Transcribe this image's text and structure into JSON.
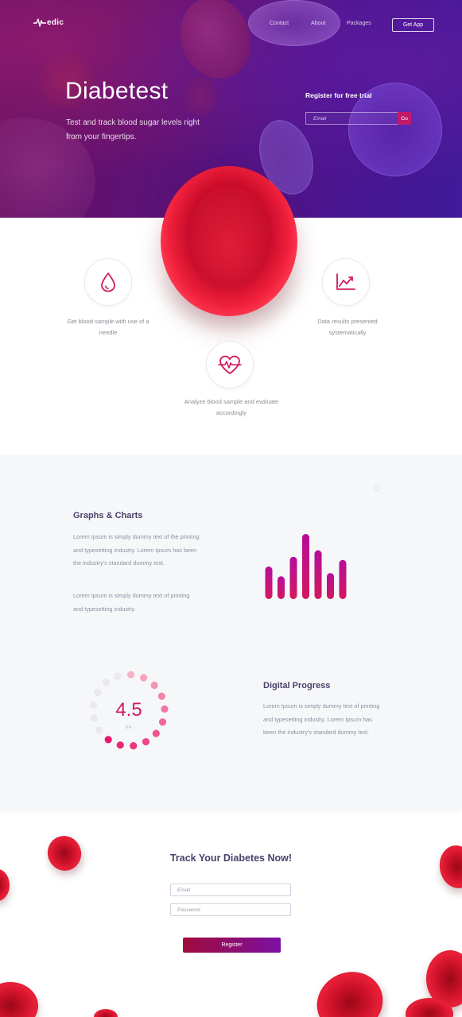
{
  "header": {
    "logo_text": "edic",
    "nav": [
      "Contact",
      "About",
      "Packages"
    ],
    "get_app_label": "Get App"
  },
  "hero": {
    "title": "Diabetest",
    "subtitle": "Test and track blood sugar levels right from your fingertips.",
    "register_label": "Register for free trial",
    "email_placeholder": "Email",
    "go_label": "Go"
  },
  "features": [
    {
      "icon": "blood-drop-icon",
      "text": "Get blood sample with use of a needle"
    },
    {
      "icon": "line-chart-icon",
      "text": "Data results presented systematically"
    },
    {
      "icon": "heart-pulse-icon",
      "text": "Analyze blood sample and evaluate accordingly"
    }
  ],
  "graphs_section": {
    "title": "Graphs & Charts",
    "paragraph_1": "Lorem Ipsum is simply dummy text of the printing and typesetting  industry. Lorem Ipsum has been the industry's standard dummy text.",
    "paragraph_2": "Lorem Ipsum is simply dummy text of printing and typesetting  industry."
  },
  "chart_data": [
    {
      "type": "bar",
      "values": [
        5,
        3.5,
        6.5,
        10,
        7.5,
        4,
        6
      ]
    }
  ],
  "progress_section": {
    "title": "Digital Progress",
    "paragraph": "Lorem Ipsum is simply dummy text of printing and typesetting  industry. Lorem Ipsum has been the industry's standard dummy text.",
    "value": "4.5",
    "unit": "NA",
    "filled_dots": 11,
    "total_dots": 17
  },
  "track_section": {
    "title": "Track Your Diabetes Now!",
    "email_placeholder": "Email",
    "password_placeholder": "Password",
    "register_label": "Register"
  },
  "colors": {
    "accent": "#d3185f",
    "hero_purple": "#4a1590",
    "blood_red": "#e01434",
    "heading": "#4b3f6b"
  }
}
